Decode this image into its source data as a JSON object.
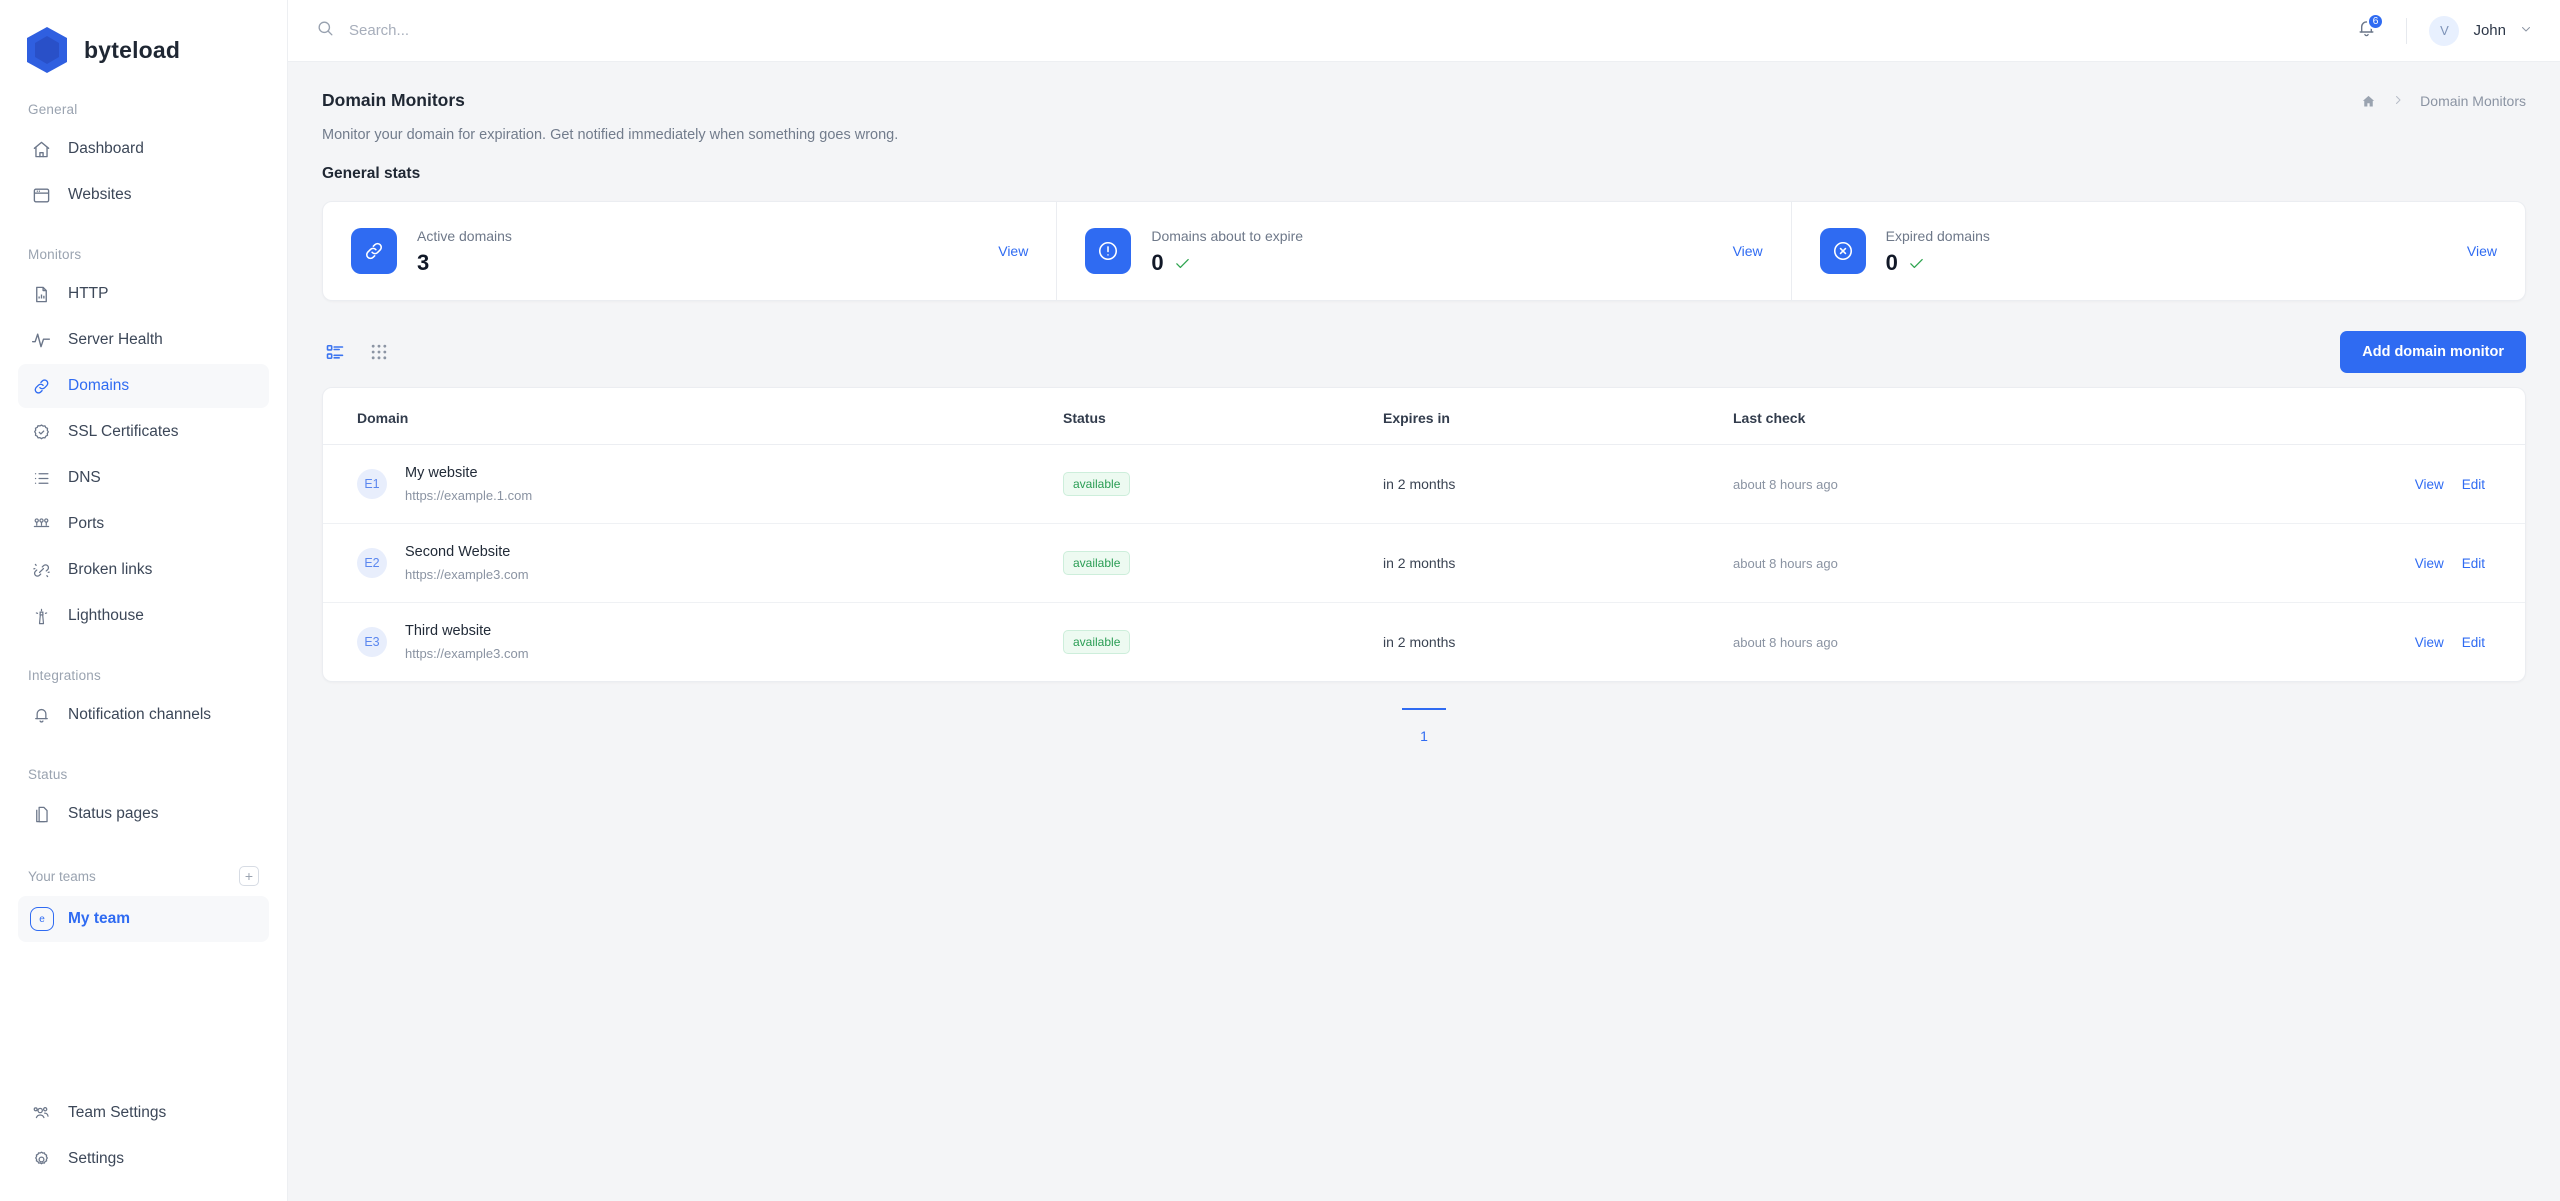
{
  "brand": {
    "name": "byteload"
  },
  "topbar": {
    "search_placeholder": "Search...",
    "search_value": "",
    "notification_count": "6",
    "user_initial": "V",
    "user_name": "John"
  },
  "sidebar": {
    "groups": [
      {
        "label": "General",
        "items": [
          {
            "label": "Dashboard",
            "icon": "home-icon",
            "active": false
          },
          {
            "label": "Websites",
            "icon": "browser-window-icon",
            "active": false
          }
        ]
      },
      {
        "label": "Monitors",
        "items": [
          {
            "label": "HTTP",
            "icon": "document-chart-icon",
            "active": false
          },
          {
            "label": "Server Health",
            "icon": "pulse-icon",
            "active": false
          },
          {
            "label": "Domains",
            "icon": "link-icon",
            "active": true
          },
          {
            "label": "SSL Certificates",
            "icon": "certificate-check-icon",
            "active": false
          },
          {
            "label": "DNS",
            "icon": "list-icon",
            "active": false
          },
          {
            "label": "Ports",
            "icon": "ports-icon",
            "active": false
          },
          {
            "label": "Broken links",
            "icon": "broken-link-icon",
            "active": false
          },
          {
            "label": "Lighthouse",
            "icon": "lighthouse-icon",
            "active": false
          }
        ]
      },
      {
        "label": "Integrations",
        "items": [
          {
            "label": "Notification channels",
            "icon": "bell-icon",
            "active": false
          }
        ]
      },
      {
        "label": "Status",
        "items": [
          {
            "label": "Status pages",
            "icon": "pages-icon",
            "active": false
          }
        ]
      }
    ],
    "teams": {
      "label": "Your teams",
      "add_label": "+",
      "items": [
        {
          "label": "My team",
          "avatar_letter": "e",
          "active": true
        }
      ]
    },
    "footer_items": [
      {
        "label": "Team Settings",
        "icon": "users-icon"
      },
      {
        "label": "Settings",
        "icon": "gear-icon"
      }
    ]
  },
  "page": {
    "title": "Domain Monitors",
    "subtitle": "Monitor your domain for expiration. Get notified immediately when something goes wrong.",
    "breadcrumb": {
      "home_icon": "home-icon",
      "separator": "›",
      "current": "Domain Monitors"
    }
  },
  "stats": {
    "section_title": "General stats",
    "cards": [
      {
        "label": "Active domains",
        "value": "3",
        "icon": "link-icon",
        "has_check": false,
        "view_label": "View"
      },
      {
        "label": "Domains about to expire",
        "value": "0",
        "icon": "alert-circle-icon",
        "has_check": true,
        "view_label": "View"
      },
      {
        "label": "Expired domains",
        "value": "0",
        "icon": "x-circle-icon",
        "has_check": true,
        "view_label": "View"
      }
    ]
  },
  "toolbar": {
    "list_view_icon": "list-view-icon",
    "grid_view_icon": "grid-view-icon",
    "add_label": "Add domain monitor"
  },
  "table": {
    "columns": [
      "Domain",
      "Status",
      "Expires in",
      "Last check",
      ""
    ],
    "rows": [
      {
        "avatar": "E1",
        "name": "My website",
        "url": "https://example.1.com",
        "status": "available",
        "expires": "in 2 months",
        "last_check": "about 8 hours ago",
        "view": "View",
        "edit": "Edit"
      },
      {
        "avatar": "E2",
        "name": "Second Website",
        "url": "https://example3.com",
        "status": "available",
        "expires": "in 2 months",
        "last_check": "about 8 hours ago",
        "view": "View",
        "edit": "Edit"
      },
      {
        "avatar": "E3",
        "name": "Third website",
        "url": "https://example3.com",
        "status": "available",
        "expires": "in 2 months",
        "last_check": "about 8 hours ago",
        "view": "View",
        "edit": "Edit"
      }
    ]
  },
  "pagination": {
    "pages": [
      "1"
    ],
    "current": "1"
  },
  "colors": {
    "accent": "#2f6bf2",
    "success": "#2a9d54",
    "badge_bg": "#edfaf1",
    "page_bg": "#f4f5f7",
    "sidebar_bg": "#ffffff"
  }
}
